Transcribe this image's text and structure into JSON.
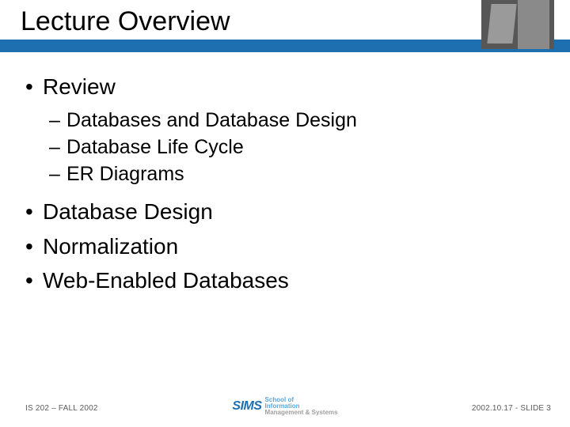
{
  "title": "Lecture Overview",
  "bullets": {
    "l1_0": "Review",
    "l2_0": "Databases and Database Design",
    "l2_1": "Database Life Cycle",
    "l2_2": "ER Diagrams",
    "l1_1": "Database Design",
    "l1_2": "Normalization",
    "l1_3": "Web-Enabled Databases"
  },
  "footer": {
    "left": "IS 202 – FALL 2002",
    "right": "2002.10.17 - SLIDE 3",
    "logo_main": "SIMS",
    "logo_line1": "School of",
    "logo_line2": "Information",
    "logo_line3": "Management & Systems"
  }
}
